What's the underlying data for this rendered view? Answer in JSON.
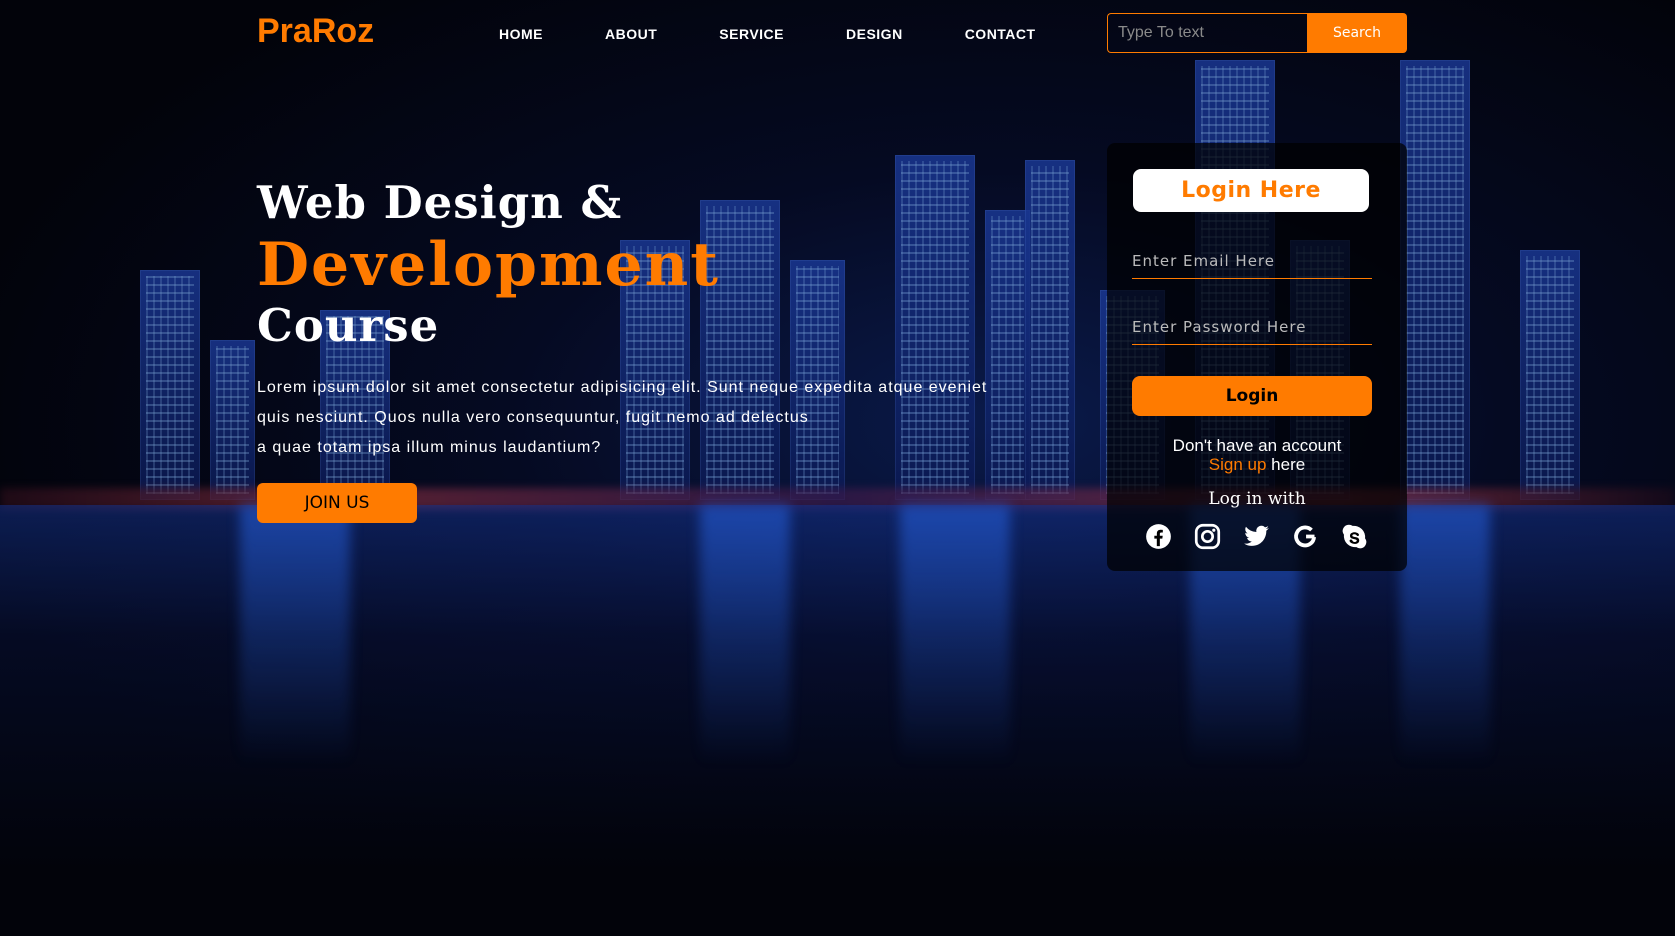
{
  "header": {
    "logo": "PraRoz",
    "nav": [
      "HOME",
      "ABOUT",
      "SERVICE",
      "DESIGN",
      "CONTACT"
    ],
    "search": {
      "placeholder": "Type To text",
      "button": "Search"
    }
  },
  "hero": {
    "line1": "Web Design &",
    "line2": "Development",
    "line3": "Course",
    "description_lines": [
      "Lorem ipsum dolor sit amet consectetur adipisicing elit. Sunt neque expedita atque eveniet",
      "quis nesciunt. Quos nulla vero consequuntur, fugit nemo ad delectus",
      "a quae totam ipsa illum minus laudantium?"
    ],
    "join_button": "JOIN US"
  },
  "login": {
    "title": "Login Here",
    "email_placeholder": "Enter Email Here",
    "password_placeholder": "Enter Password Here",
    "button": "Login",
    "no_account": "Don't have an account",
    "signup_link": "Sign up",
    "signup_suffix": " here",
    "login_with": "Log in with",
    "socials": [
      "facebook-icon",
      "instagram-icon",
      "twitter-icon",
      "google-icon",
      "skype-icon"
    ]
  },
  "colors": {
    "accent": "#ff7b00",
    "background": "#03050f"
  }
}
